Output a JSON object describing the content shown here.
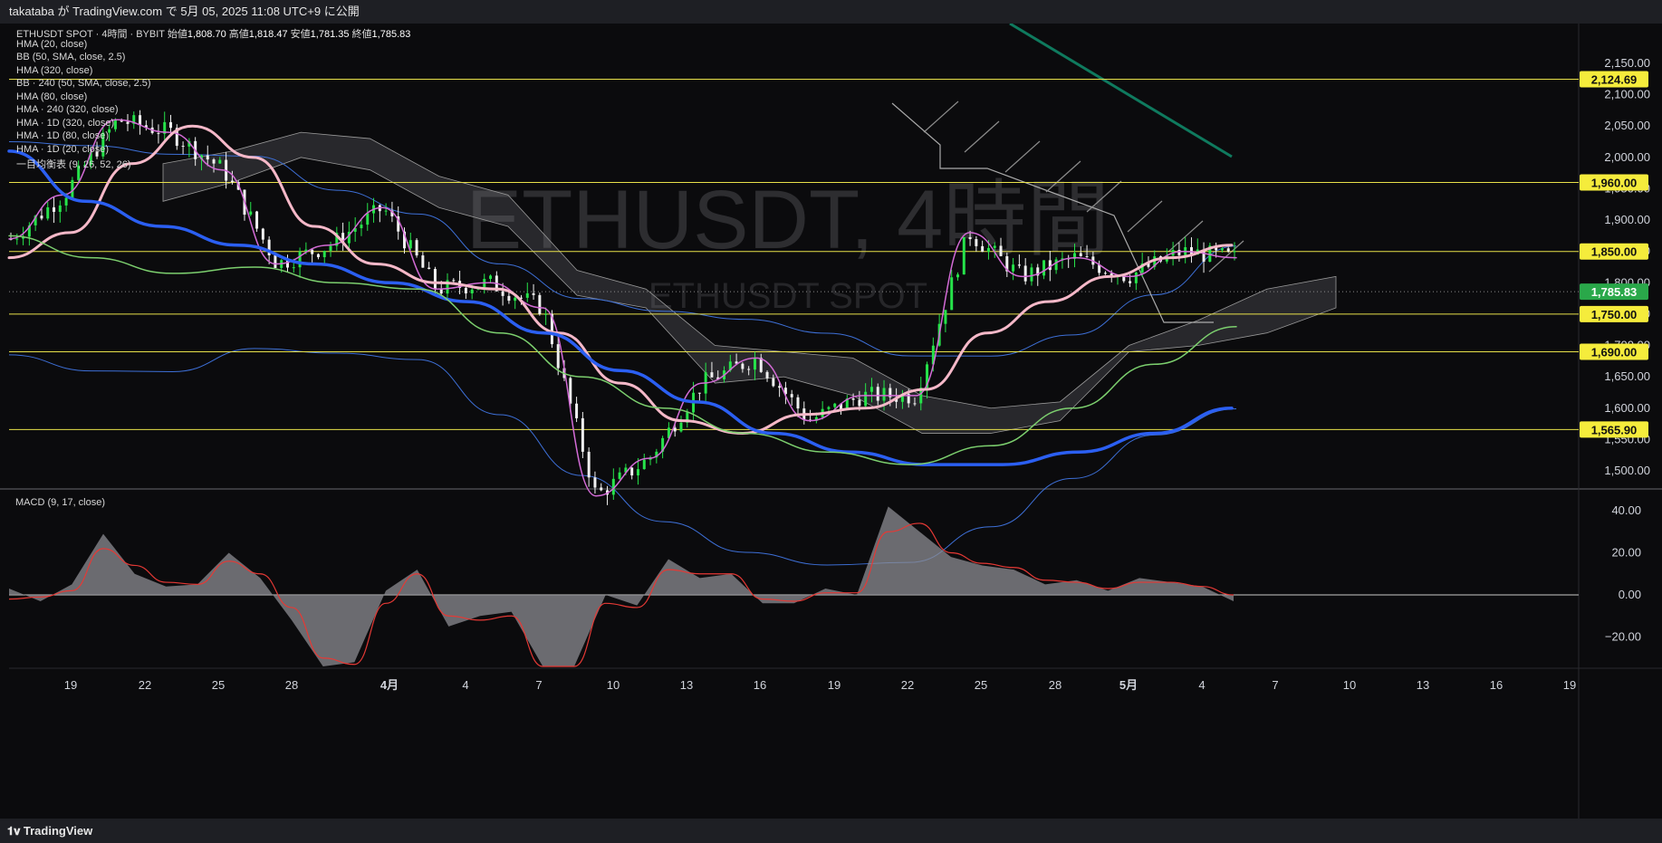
{
  "header": {
    "publish_text": "takataba が TradingView.com で 5月 05, 2025 11:08 UTC+9 に公開"
  },
  "footer": {
    "brand": "TradingView"
  },
  "symbol_line": {
    "symbol": "ETHUSDT SPOT · 4時間 · BYBIT",
    "open_label": "始値",
    "open": "1,808.70",
    "high_label": "高値",
    "high": "1,818.47",
    "low_label": "安値",
    "low": "1,781.35",
    "close_label": "終値",
    "close": "1,785.83"
  },
  "indicators": [
    "HMA (20, close)",
    "BB (50, SMA, close, 2.5)",
    "HMA (320, close)",
    "BB · 240 (50, SMA, close, 2.5)",
    "HMA (80, close)",
    "HMA · 240 (320, close)",
    "HMA · 1D (320, close)",
    "HMA · 1D (80, close)",
    "HMA · 1D (20, close)",
    "一目均衡表 (9, 26, 52, 26)"
  ],
  "watermark": {
    "title": "ETHUSDT, 4時間",
    "subtitle": "ETHUSDT SPOT"
  },
  "colors": {
    "up": "#26e34a",
    "down": "#f0f0f0",
    "price_line": "#e8e14a",
    "price_tag": "#f5ec3c",
    "current": "#2aa84a",
    "macd_line": "#e53935"
  },
  "chart_data": [
    {
      "type": "line",
      "title": "ETHUSDT SPOT · 4時間 · BYBIT",
      "x_tick_labels": [
        "19",
        "22",
        "25",
        "28",
        "4月",
        "4",
        "7",
        "10",
        "13",
        "16",
        "19",
        "22",
        "25",
        "28",
        "5月",
        "4",
        "7",
        "10",
        "13",
        "16",
        "19"
      ],
      "y_tick_labels": [
        "2,150.00",
        "2,100.00",
        "2,050.00",
        "2,000.00",
        "1,950.00",
        "1,900.00",
        "1,850.00",
        "1,800.00",
        "1,750.00",
        "1,700.00",
        "1,650.00",
        "1,600.00",
        "1,550.00",
        "1,500.00"
      ],
      "ylim": [
        1470,
        2170
      ],
      "horizontal_levels": [
        "2,124.69",
        "1,960.00",
        "1,850.00",
        "1,750.00",
        "1,690.00",
        "1,565.90"
      ],
      "current_price": "1,785.83",
      "series": [
        {
          "name": "HMA (20, close)",
          "color": "#d36bd6",
          "values": [
            1870,
            1940,
            2060,
            2040,
            1980,
            1830,
            1860,
            1920,
            1790,
            1800,
            1760,
            1460,
            1520,
            1640,
            1680,
            1580,
            1620,
            1620,
            1880,
            1810,
            1840,
            1810,
            1850,
            1840
          ]
        },
        {
          "name": "HMA (80, close)",
          "color": "#f5b8c8",
          "values": [
            1840,
            1880,
            1990,
            2050,
            2000,
            1890,
            1830,
            1800,
            1790,
            1720,
            1640,
            1580,
            1560,
            1590,
            1600,
            1630,
            1720,
            1770,
            1810,
            1840,
            1860
          ]
        },
        {
          "name": "HMA (320, close)",
          "color": "#2b5ff2",
          "values": [
            2010,
            1930,
            1890,
            1860,
            1830,
            1800,
            1770,
            1720,
            1660,
            1610,
            1560,
            1530,
            1510,
            1510,
            1530,
            1560,
            1600
          ]
        },
        {
          "name": "BB (50, SMA, close, 2.5) basis",
          "color": "#7ccf6e",
          "values": [
            1875,
            1840,
            1815,
            1825,
            1800,
            1790,
            1720,
            1650,
            1600,
            1560,
            1530,
            1510,
            1540,
            1600,
            1670,
            1730
          ]
        }
      ]
    },
    {
      "type": "area",
      "title": "MACD (9, 17, close)",
      "y_tick_labels": [
        "40.00",
        "20.00",
        "0.00",
        "−20.00"
      ],
      "ylim": [
        -34,
        46
      ],
      "series": [
        {
          "name": "MACD",
          "color": "#8a8a8e",
          "values": [
            3,
            -3,
            5,
            29,
            10,
            4,
            5,
            20,
            8,
            -12,
            -35,
            -32,
            2,
            12,
            -15,
            -10,
            -8,
            -42,
            -36,
            0,
            -5,
            17,
            8,
            10,
            -4,
            -4,
            3,
            0,
            42,
            30,
            18,
            14,
            12,
            5,
            7,
            2,
            8,
            6,
            4,
            -3
          ]
        },
        {
          "name": "Signal",
          "color": "#e53935",
          "values": [
            -2,
            -1,
            2,
            22,
            14,
            6,
            5,
            16,
            10,
            -6,
            -30,
            -33,
            -4,
            10,
            -10,
            -12,
            -10,
            -45,
            -34,
            -4,
            -6,
            12,
            10,
            10,
            -2,
            -3,
            1,
            1,
            30,
            34,
            20,
            15,
            13,
            7,
            6,
            3,
            6,
            6,
            4,
            0
          ]
        }
      ]
    }
  ]
}
